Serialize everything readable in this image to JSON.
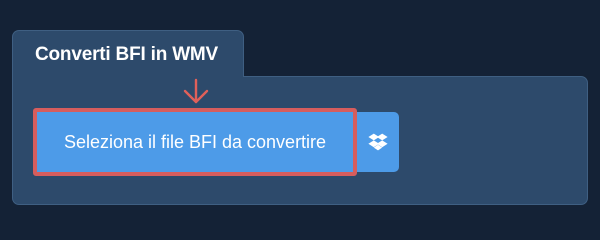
{
  "converter": {
    "tab_title": "Converti BFI in WMV",
    "select_file_label": "Seleziona il file BFI da convertire"
  },
  "icons": {
    "annotation": "arrow-down-icon",
    "cloud_service": "dropbox-icon"
  },
  "colors": {
    "page_background": "#142236",
    "panel_background": "#2d4a6b",
    "button_background": "#4d9be8",
    "highlight_border": "#d65d5d"
  }
}
